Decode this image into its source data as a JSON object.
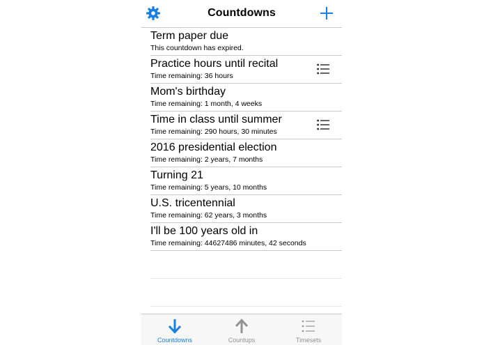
{
  "navbar": {
    "title": "Countdowns",
    "left_icon": "gear-icon",
    "right_icon": "plus-icon"
  },
  "countdowns": [
    {
      "title": "Term paper due",
      "subtitle": "This countdown has expired.",
      "has_list_icon": false
    },
    {
      "title": "Practice hours until recital",
      "subtitle": "Time remaining: 36 hours",
      "has_list_icon": true
    },
    {
      "title": "Mom's birthday",
      "subtitle": "Time remaining: 1 month, 4 weeks",
      "has_list_icon": false
    },
    {
      "title": "Time in class until summer",
      "subtitle": "Time remaining: 290 hours, 30 minutes",
      "has_list_icon": true
    },
    {
      "title": "2016 presidential election",
      "subtitle": "Time remaining: 2 years, 7 months",
      "has_list_icon": false
    },
    {
      "title": "Turning 21",
      "subtitle": "Time remaining: 5 years, 10 months",
      "has_list_icon": false
    },
    {
      "title": "U.S. tricentennial",
      "subtitle": "Time remaining: 62 years, 3 months",
      "has_list_icon": false
    },
    {
      "title": "I'll be 100 years old in",
      "subtitle": "Time remaining: 44627486 minutes, 42 seconds",
      "has_list_icon": false
    }
  ],
  "tabs": [
    {
      "label": "Countdowns",
      "icon": "arrow-down-icon",
      "active": true
    },
    {
      "label": "Countups",
      "icon": "arrow-up-icon",
      "active": false
    },
    {
      "label": "Timesets",
      "icon": "list-icon",
      "active": false
    }
  ],
  "colors": {
    "accent": "#1a7fe0",
    "inactive": "#929292",
    "separator": "#c8c7cc",
    "tabbar_bg": "#f7f7f7"
  }
}
